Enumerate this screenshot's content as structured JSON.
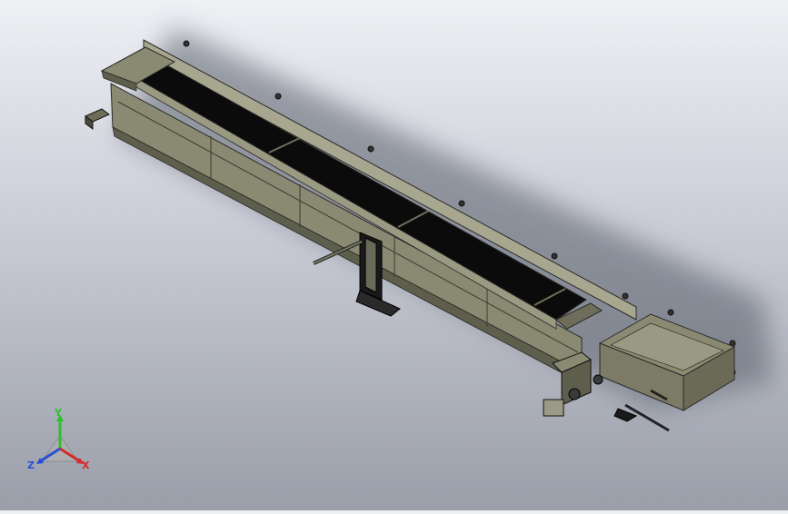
{
  "colors": {
    "frame": "#8a8a72",
    "frame_dark": "#5e5e4c",
    "frame_light": "#a7a78f",
    "belt": "#0b0b0b",
    "edges": "#2a2a2a",
    "triad_x": "#d42a2a",
    "triad_y": "#2fbf2f",
    "triad_z": "#2a4fd4"
  },
  "triad": {
    "x_label": "X",
    "y_label": "Y",
    "z_label": "Z"
  }
}
